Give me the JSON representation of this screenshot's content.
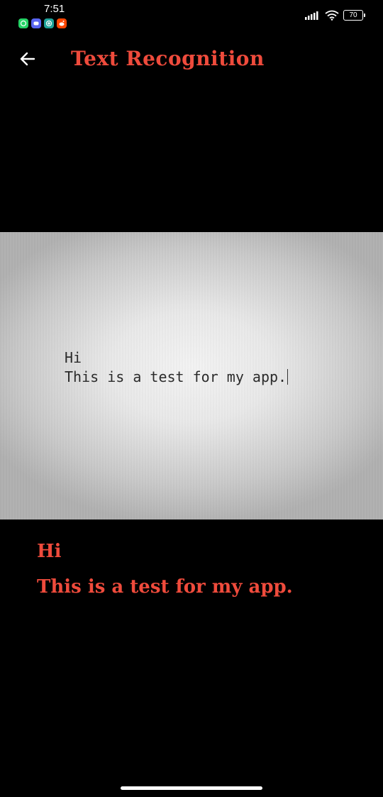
{
  "status_bar": {
    "time": "7:51",
    "battery": "70",
    "notifications": [
      {
        "name": "whatsapp-icon",
        "color": "#25d366"
      },
      {
        "name": "discord-icon",
        "color": "#5865f2"
      },
      {
        "name": "messenger-icon",
        "color": "#1fa39a"
      },
      {
        "name": "reddit-icon",
        "color": "#ff4500"
      }
    ]
  },
  "app_bar": {
    "title": "Text Recognition",
    "back_icon": "arrow-left-icon"
  },
  "photo": {
    "line1": "Hi",
    "line2": "This is a test for my app."
  },
  "result": {
    "line1": "Hi",
    "line2": "This is a test for my app."
  },
  "colors": {
    "accent": "#ef4b3c",
    "background": "#000000"
  }
}
